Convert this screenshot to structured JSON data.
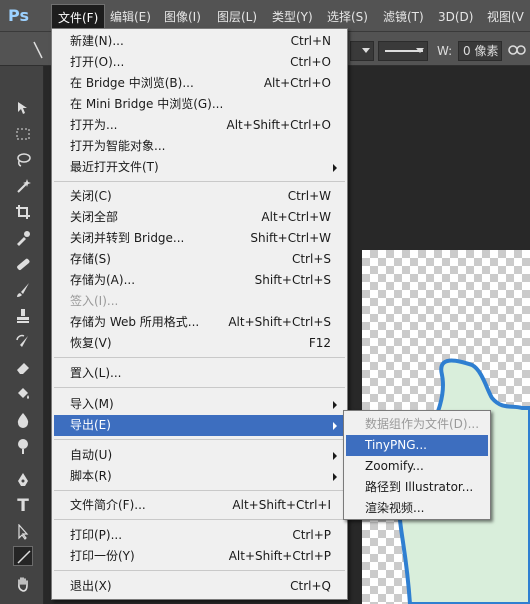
{
  "app": {
    "logo": "Ps"
  },
  "menubar": {
    "items": [
      {
        "label": "文件(F)"
      },
      {
        "label": "编辑(E)"
      },
      {
        "label": "图像(I)"
      },
      {
        "label": "图层(L)"
      },
      {
        "label": "类型(Y)"
      },
      {
        "label": "选择(S)"
      },
      {
        "label": "滤镜(T)"
      },
      {
        "label": "3D(D)"
      },
      {
        "label": "视图(V"
      }
    ]
  },
  "options": {
    "width_label": "W:",
    "width_value": "0 像素"
  },
  "file_menu": {
    "items": [
      {
        "label": "新建(N)...",
        "shortcut": "Ctrl+N"
      },
      {
        "label": "打开(O)...",
        "shortcut": "Ctrl+O"
      },
      {
        "label": "在 Bridge 中浏览(B)...",
        "shortcut": "Alt+Ctrl+O"
      },
      {
        "label": "在 Mini Bridge 中浏览(G)...",
        "shortcut": ""
      },
      {
        "label": "打开为...",
        "shortcut": "Alt+Shift+Ctrl+O"
      },
      {
        "label": "打开为智能对象...",
        "shortcut": ""
      },
      {
        "label": "最近打开文件(T)",
        "shortcut": "",
        "submenu": true
      },
      {
        "label": "关闭(C)",
        "shortcut": "Ctrl+W"
      },
      {
        "label": "关闭全部",
        "shortcut": "Alt+Ctrl+W"
      },
      {
        "label": "关闭并转到 Bridge...",
        "shortcut": "Shift+Ctrl+W"
      },
      {
        "label": "存储(S)",
        "shortcut": "Ctrl+S"
      },
      {
        "label": "存储为(A)...",
        "shortcut": "Shift+Ctrl+S"
      },
      {
        "label": "签入(I)...",
        "shortcut": "",
        "disabled": true
      },
      {
        "label": "存储为 Web 所用格式...",
        "shortcut": "Alt+Shift+Ctrl+S"
      },
      {
        "label": "恢复(V)",
        "shortcut": "F12"
      },
      {
        "label": "置入(L)...",
        "shortcut": ""
      },
      {
        "label": "导入(M)",
        "shortcut": "",
        "submenu": true
      },
      {
        "label": "导出(E)",
        "shortcut": "",
        "submenu": true,
        "selected": true
      },
      {
        "label": "自动(U)",
        "shortcut": "",
        "submenu": true
      },
      {
        "label": "脚本(R)",
        "shortcut": "",
        "submenu": true
      },
      {
        "label": "文件简介(F)...",
        "shortcut": "Alt+Shift+Ctrl+I"
      },
      {
        "label": "打印(P)...",
        "shortcut": "Ctrl+P"
      },
      {
        "label": "打印一份(Y)",
        "shortcut": "Alt+Shift+Ctrl+P"
      },
      {
        "label": "退出(X)",
        "shortcut": "Ctrl+Q"
      }
    ]
  },
  "export_submenu": {
    "items": [
      {
        "label": "数据组作为文件(D)...",
        "disabled": true
      },
      {
        "label": "TinyPNG...",
        "selected": true
      },
      {
        "label": "Zoomify..."
      },
      {
        "label": "路径到 Illustrator..."
      },
      {
        "label": "渲染视频..."
      }
    ]
  },
  "colors": {
    "accent": "#3d6ebf",
    "menu_bg": "#f0f0f0",
    "ui_dark": "#535353",
    "shape_fill": "#d9eedb",
    "shape_stroke": "#2f7fd1"
  }
}
